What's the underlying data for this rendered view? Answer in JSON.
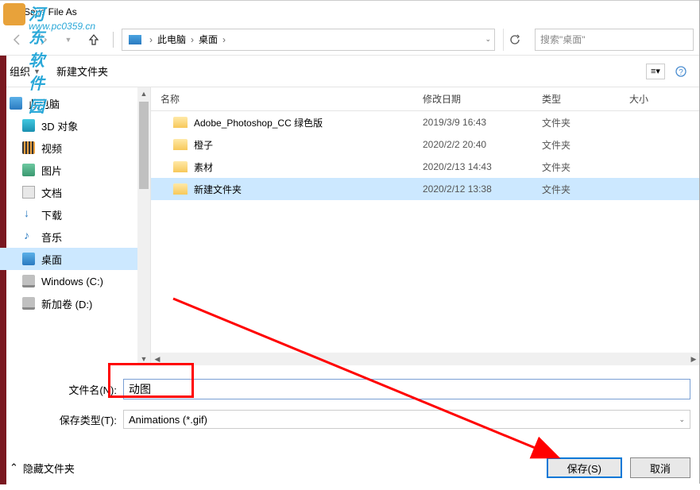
{
  "title": "Save File As",
  "watermark": {
    "text": "河东软件园",
    "url": "www.pc0359.cn"
  },
  "breadcrumb": {
    "p1": "此电脑",
    "p2": "桌面"
  },
  "search": {
    "placeholder": "搜索\"桌面\""
  },
  "toolbar": {
    "organize": "组织",
    "new_folder": "新建文件夹"
  },
  "columns": {
    "name": "名称",
    "date": "修改日期",
    "type": "类型",
    "size": "大小"
  },
  "sidebar": {
    "root": "此电脑",
    "items": [
      "3D 对象",
      "视频",
      "图片",
      "文档",
      "下载",
      "音乐",
      "桌面",
      "Windows (C:)",
      "新加卷 (D:)"
    ]
  },
  "files": [
    {
      "name": "Adobe_Photoshop_CC 绿色版",
      "date": "2019/3/9 16:43",
      "type": "文件夹"
    },
    {
      "name": "橙子",
      "date": "2020/2/2 20:40",
      "type": "文件夹"
    },
    {
      "name": "素材",
      "date": "2020/2/13 14:43",
      "type": "文件夹"
    },
    {
      "name": "新建文件夹",
      "date": "2020/2/12 13:38",
      "type": "文件夹"
    }
  ],
  "fields": {
    "filename_label": "文件名(N):",
    "filename_value": "动图",
    "filetype_label": "保存类型(T):",
    "filetype_value": "Animations (*.gif)"
  },
  "footer": {
    "hide_folders": "隐藏文件夹",
    "save": "保存(S)",
    "cancel": "取消"
  }
}
